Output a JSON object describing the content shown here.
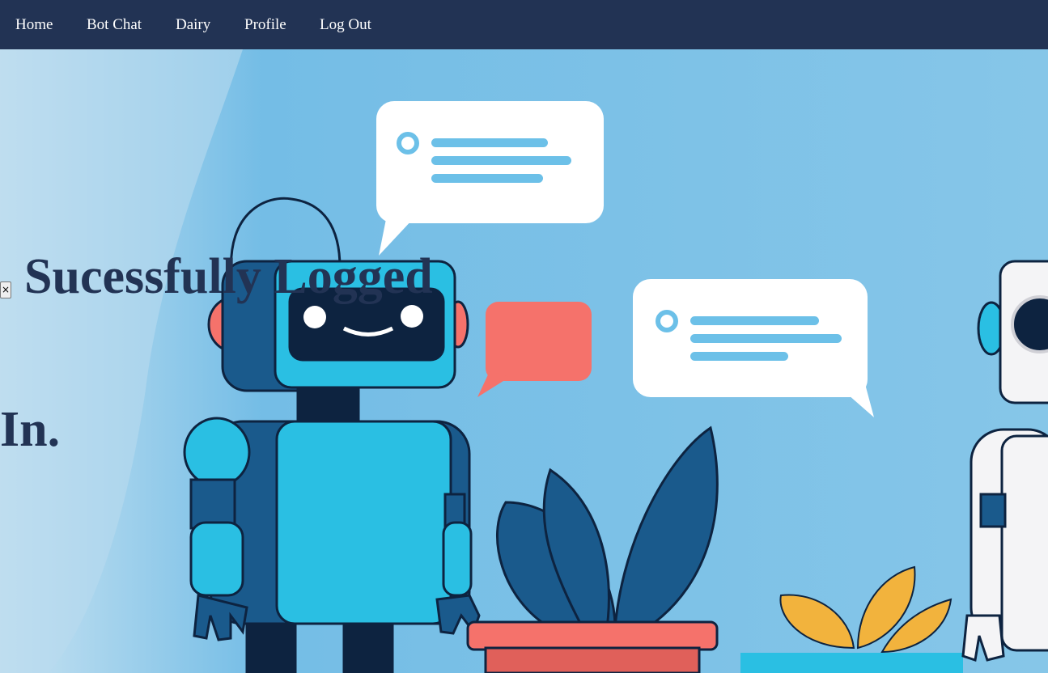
{
  "nav": {
    "items": [
      {
        "label": "Home"
      },
      {
        "label": "Bot Chat"
      },
      {
        "label": "Dairy"
      },
      {
        "label": "Profile"
      },
      {
        "label": "Log Out"
      }
    ]
  },
  "alert": {
    "close_symbol": "×",
    "message_line1": "Sucessfully Logged",
    "message_line2": "In."
  },
  "colors": {
    "navbar": "#223354",
    "nav_text": "#ffffff",
    "message_text": "#223354",
    "sky": "#7cc0e6",
    "robot_blue": "#2abfe3",
    "robot_dark": "#1a5a8c",
    "bubble_red": "#f5726b",
    "leaf_yellow": "#f2b33d"
  },
  "icons": {
    "close": "close-icon",
    "illustration": "robots-chat-illustration"
  }
}
